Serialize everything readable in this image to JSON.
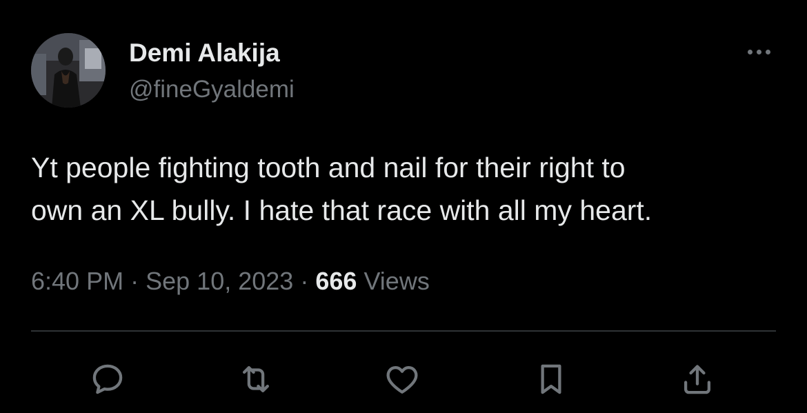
{
  "author": {
    "display_name": "Demi Alakija",
    "handle": "@fineGyaldemi",
    "avatar_icon": "profile-photo"
  },
  "tweet": {
    "text_lines": [
      "Yt people fighting tooth and nail for their right to",
      "own an XL bully. I hate that race with all my heart."
    ]
  },
  "meta": {
    "time": "6:40 PM",
    "separator": "·",
    "date": "Sep 10, 2023",
    "views_count": "666",
    "views_label": "Views"
  },
  "actions": [
    {
      "name": "reply",
      "icon": "speech-bubble-icon"
    },
    {
      "name": "repost",
      "icon": "repost-icon"
    },
    {
      "name": "like",
      "icon": "heart-icon"
    },
    {
      "name": "bookmark",
      "icon": "bookmark-icon"
    },
    {
      "name": "share",
      "icon": "share-icon"
    }
  ],
  "more_menu_icon": "ellipsis-icon",
  "colors": {
    "background": "#000000",
    "primary_text": "#e7e9ea",
    "secondary_text": "#71767b",
    "divider": "#2f3336"
  }
}
